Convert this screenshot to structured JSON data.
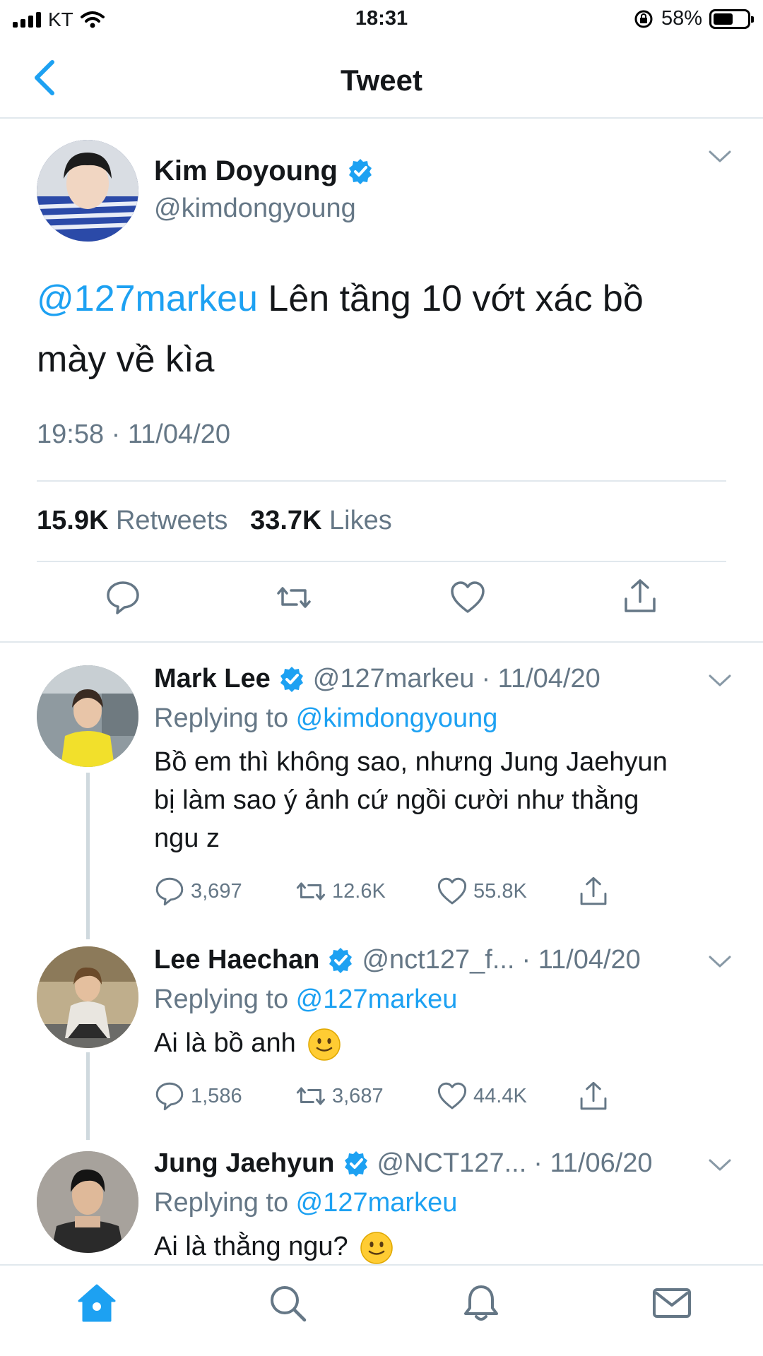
{
  "status_bar": {
    "carrier": "KT",
    "time": "18:31",
    "battery": "58%",
    "battery_level": 0.58
  },
  "nav": {
    "title": "Tweet",
    "back_icon": "chevron-left-icon"
  },
  "tweet": {
    "author_name": "Kim Doyoung",
    "handle": "@kimdongyoung",
    "mention": "@127markeu",
    "text_line1": " Lên tầng 10 vớt xác bồ",
    "text_line2": "mày về kìa",
    "timestamp": "19:58 · 11/04/20",
    "retweets_count": "15.9K",
    "retweets_label": "Retweets",
    "likes_count": "33.7K",
    "likes_label": "Likes"
  },
  "replies": [
    {
      "name": "Mark Lee",
      "handle": "@127markeu",
      "date": "· 11/04/20",
      "replying_label": "Replying to ",
      "replying_to": "@kimdongyoung",
      "text_lines": [
        "Bồ em thì không sao, nhưng Jung Jaehyun",
        "bị làm sao ý ảnh cứ ngồi cười như thằng",
        "ngu z"
      ],
      "replies": "3,697",
      "retweets": "12.6K",
      "likes": "55.8K"
    },
    {
      "name": "Lee Haechan",
      "handle": "@nct127_f...",
      "date": "· 11/04/20",
      "replying_label": "Replying to ",
      "replying_to": "@127markeu",
      "text": "Ai là bồ anh",
      "replies": "1,586",
      "retweets": "3,687",
      "likes": "44.4K"
    },
    {
      "name": "Jung Jaehyun",
      "handle": "@NCT127...",
      "date": "· 11/06/20",
      "replying_label": "Replying to ",
      "replying_to": "@127markeu",
      "text": "Ai là thằng ngu?"
    }
  ],
  "tabbar": [
    "home-icon",
    "search-icon",
    "bell-icon",
    "mail-icon"
  ],
  "colors": {
    "accent": "#1da1f2",
    "secondary_text": "#657786",
    "divider": "#e1e8ed"
  }
}
